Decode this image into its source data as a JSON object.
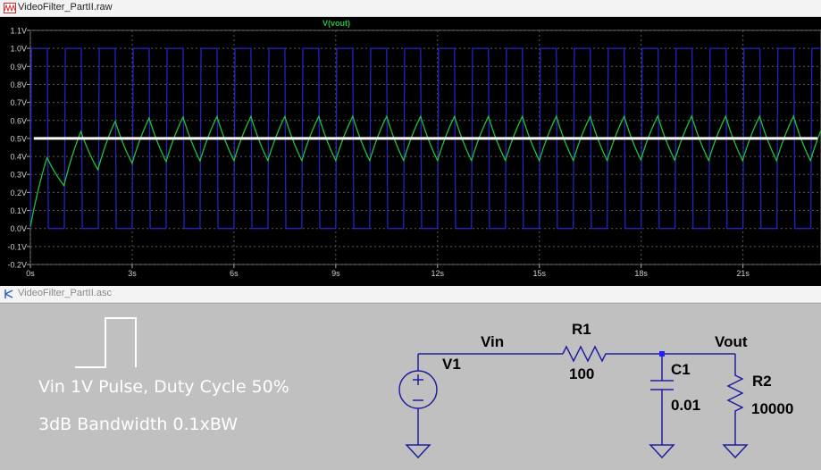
{
  "waveform_window": {
    "title": "VideoFilter_PartII.raw",
    "trace_label": "V(vout)"
  },
  "schematic_window": {
    "title": "VideoFilter_PartII.asc"
  },
  "colors": {
    "plot_bg": "#000000",
    "input_trace": "#2323c8",
    "output_trace": "#22c13a",
    "reference_line": "#ffffff",
    "grid": "#5a5a5a",
    "axis_text": "#d0d0d0",
    "schematic_bg": "#c0c0c0",
    "wire": "#1f1fa0",
    "component": "#1f1fa0",
    "junction": "#1f1fff"
  },
  "chart_data": {
    "type": "line",
    "title": "V(vout)",
    "xlabel": "",
    "ylabel": "",
    "xlim": [
      0,
      23.3
    ],
    "ylim": [
      -0.2,
      1.1
    ],
    "x_ticks": [
      {
        "v": 0,
        "label": "0s"
      },
      {
        "v": 3,
        "label": "3s"
      },
      {
        "v": 6,
        "label": "6s"
      },
      {
        "v": 9,
        "label": "9s"
      },
      {
        "v": 12,
        "label": "12s"
      },
      {
        "v": 15,
        "label": "15s"
      },
      {
        "v": 18,
        "label": "18s"
      },
      {
        "v": 21,
        "label": "21s"
      }
    ],
    "y_ticks": [
      {
        "v": 1.1,
        "label": "1.1V"
      },
      {
        "v": 1.0,
        "label": "1.0V"
      },
      {
        "v": 0.9,
        "label": "0.9V"
      },
      {
        "v": 0.8,
        "label": "0.8V"
      },
      {
        "v": 0.7,
        "label": "0.7V"
      },
      {
        "v": 0.6,
        "label": "0.6V"
      },
      {
        "v": 0.5,
        "label": "0.5V"
      },
      {
        "v": 0.4,
        "label": "0.4V"
      },
      {
        "v": 0.3,
        "label": "0.3V"
      },
      {
        "v": 0.2,
        "label": "0.2V"
      },
      {
        "v": 0.1,
        "label": "0.1V"
      },
      {
        "v": 0.0,
        "label": "0.0V"
      },
      {
        "v": -0.1,
        "label": "-0.1V"
      },
      {
        "v": -0.2,
        "label": "-0.2V"
      }
    ],
    "grid": true,
    "series": [
      {
        "name": "",
        "role": "input",
        "kind": "pulse",
        "low": 0.0,
        "high": 1.0,
        "period": 1.0,
        "duty": 0.5,
        "t_end": 23.3
      },
      {
        "name": "V(vout)",
        "role": "output",
        "kind": "rc_response",
        "tau": 1.0,
        "final_ripple_max": 0.64,
        "final_ripple_min": 0.42,
        "period": 1.0,
        "t_end": 23.3
      },
      {
        "name": "",
        "role": "reference",
        "kind": "hline",
        "y": 0.5
      }
    ]
  },
  "schematic": {
    "notes": [
      "Vin 1V Pulse, Duty Cycle 50%",
      "3dB Bandwidth 0.1xBW"
    ],
    "nets": {
      "vin": "Vin",
      "vout": "Vout"
    },
    "components": [
      {
        "ref": "V1",
        "value": ""
      },
      {
        "ref": "R1",
        "value": "100"
      },
      {
        "ref": "C1",
        "value": "0.01"
      },
      {
        "ref": "R2",
        "value": "10000"
      }
    ]
  }
}
